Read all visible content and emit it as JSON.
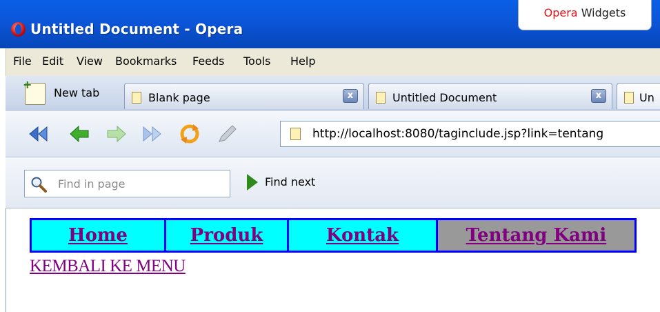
{
  "window": {
    "title": "Untitled Document - Opera",
    "widgets_brand": "Opera",
    "widgets_label": "Widgets"
  },
  "menu": [
    "File",
    "Edit",
    "View",
    "Bookmarks",
    "Feeds",
    "Tools",
    "Help"
  ],
  "tabs": {
    "new_tab_label": "New tab",
    "items": [
      {
        "label": "Blank page",
        "closable": true
      },
      {
        "label": "Untitled Document",
        "closable": true
      },
      {
        "label": "Un",
        "closable": false
      }
    ]
  },
  "toolbar": {
    "icons": [
      "rewind-icon",
      "back-icon",
      "forward-icon",
      "fast-forward-icon",
      "reload-icon",
      "edit-icon"
    ],
    "address": "http://localhost:8080/taginclude.jsp?link=tentang"
  },
  "findbar": {
    "placeholder": "Find in page",
    "find_next_label": "Find next"
  },
  "page": {
    "nav": [
      {
        "label": "Home",
        "active": false
      },
      {
        "label": "Produk",
        "active": false
      },
      {
        "label": "Kontak",
        "active": false
      },
      {
        "label": "Tentang Kami",
        "active": true
      }
    ],
    "back_link": "KEMBALI KE MENU"
  },
  "colors": {
    "titlebar": "#0b55d8",
    "nav_cell": "#00ffff",
    "nav_active": "#999999",
    "nav_border": "#0000ff",
    "visited_link": "#800080"
  }
}
